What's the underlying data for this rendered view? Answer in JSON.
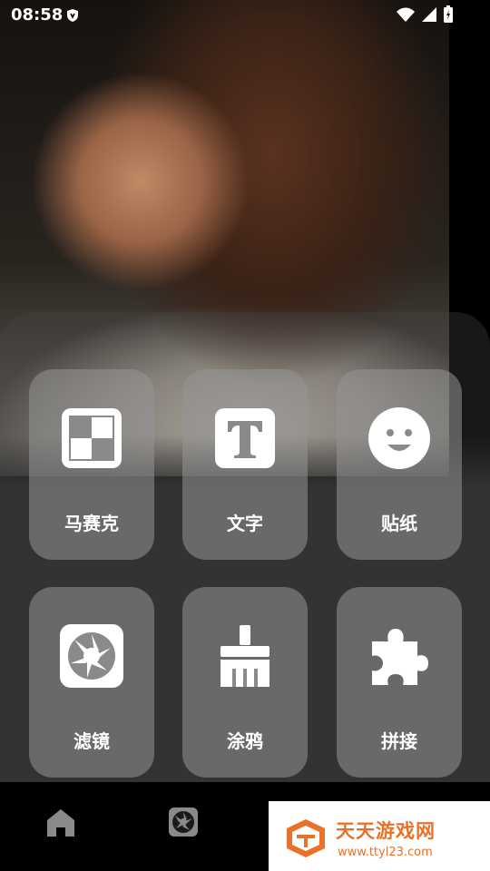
{
  "status_bar": {
    "time": "08:58"
  },
  "tools": [
    {
      "label": "马赛克",
      "icon": "mosaic-icon"
    },
    {
      "label": "文字",
      "icon": "text-icon"
    },
    {
      "label": "贴纸",
      "icon": "sticker-icon"
    },
    {
      "label": "滤镜",
      "icon": "filter-icon"
    },
    {
      "label": "涂鸦",
      "icon": "brush-icon"
    },
    {
      "label": "拼接",
      "icon": "puzzle-icon"
    }
  ],
  "bottom_nav": {
    "home_icon": "home-icon",
    "camera_icon": "camera-icon"
  },
  "watermark": {
    "title": "天天游戏网",
    "url": "www.ttyl23.com"
  },
  "colors": {
    "tile": "#8f8f8f",
    "watermark": "#e9712a"
  }
}
